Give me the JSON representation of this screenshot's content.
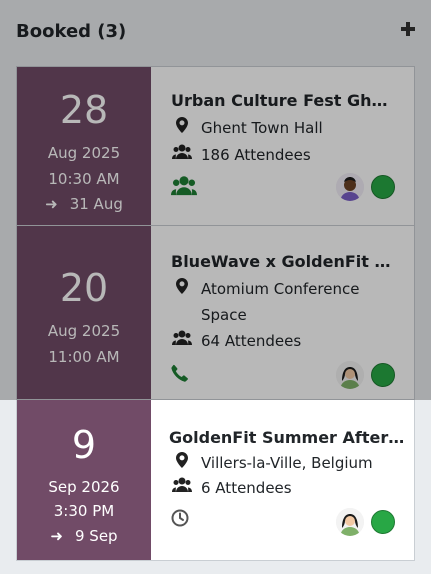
{
  "column": {
    "title": "Booked (3)",
    "add_icon": "plus-icon"
  },
  "colors": {
    "date_bg": "#714B67",
    "status_green": "#28a745",
    "icon_green": "#1e7e34"
  },
  "cards": [
    {
      "day": "28",
      "month_year": "Aug 2025",
      "time": "10:30 AM",
      "end_date": "31 Aug",
      "name": "Urban Culture Fest Gh…",
      "location": "Ghent Town Hall",
      "attendees": "186 Attendees",
      "activity_icon": "users-icon",
      "avatar": "avatar-man-icon",
      "status": "status-green-dot"
    },
    {
      "day": "20",
      "month_year": "Aug 2025",
      "time": "11:00 AM",
      "name": "BlueWave x GoldenFit …",
      "location_line1": "Atomium Conference",
      "location_line2": "Space",
      "attendees": "64 Attendees",
      "activity_icon": "phone-icon",
      "avatar": "avatar-woman-icon",
      "status": "status-green-dot"
    },
    {
      "day": "9",
      "month_year": "Sep 2026",
      "time": "3:30 PM",
      "end_date": "9 Sep",
      "name": "GoldenFit Summer After…",
      "location": "Villers-la-Ville, Belgium",
      "attendees": "6 Attendees",
      "activity_icon": "clock-icon",
      "avatar": "avatar-woman-icon",
      "status": "status-green-dot"
    }
  ]
}
